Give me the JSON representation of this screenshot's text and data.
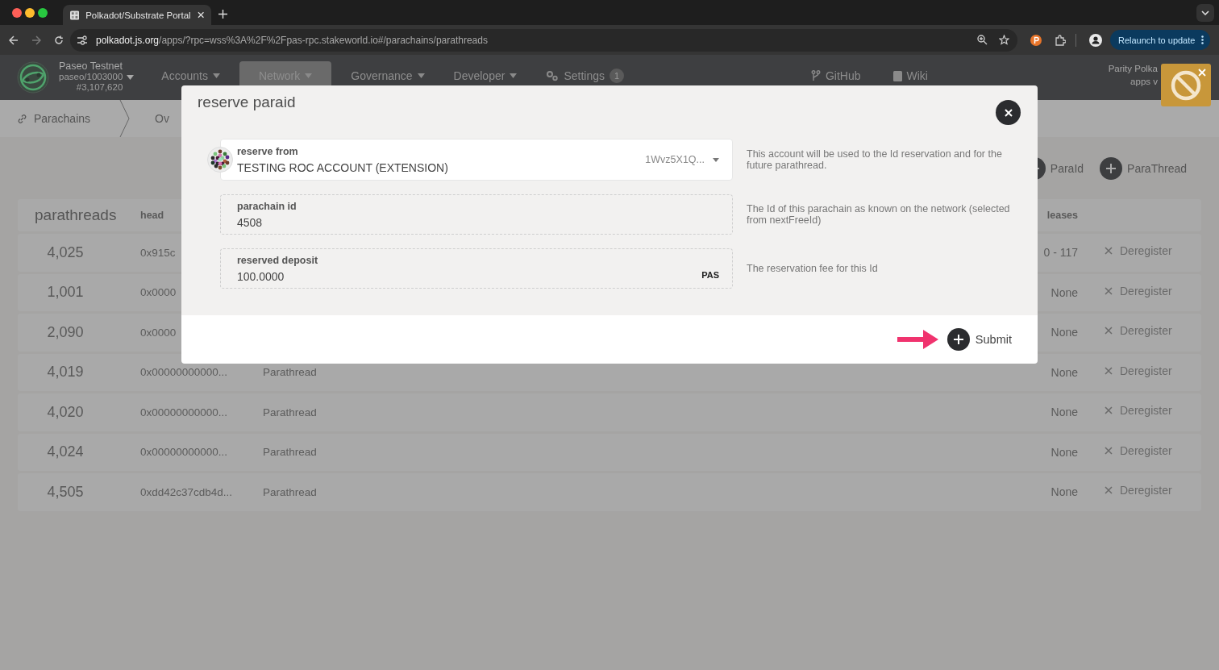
{
  "browser": {
    "tab_title": "Polkadot/Substrate Portal",
    "url_host": "polkadot.js.org",
    "url_rest": "/apps/?rpc=wss%3A%2F%2Fpas-rpc.stakeworld.io#/parachains/parathreads",
    "relaunch_button": "Relaunch to update"
  },
  "header": {
    "chain_name": "Paseo Testnet",
    "chain_spec": "paseo/1003000",
    "block": "#3,107,620",
    "nav": [
      {
        "label": "Accounts",
        "kind": "menu",
        "selected": false
      },
      {
        "label": "Network",
        "kind": "menu",
        "selected": true
      },
      {
        "label": "Governance",
        "kind": "menu",
        "selected": false
      },
      {
        "label": "Developer",
        "kind": "menu",
        "selected": false
      },
      {
        "label": "Settings",
        "kind": "settings",
        "selected": false,
        "badge": "1"
      },
      {
        "label": "GitHub",
        "kind": "github",
        "selected": false
      },
      {
        "label": "Wiki",
        "kind": "wiki",
        "selected": false
      }
    ],
    "version_lines": [
      "Parity Polka",
      "apps v"
    ]
  },
  "breadcrumb": {
    "section": "Parachains",
    "tab": "Ov"
  },
  "actions": [
    {
      "label": "ParaId"
    },
    {
      "label": "ParaThread"
    }
  ],
  "table": {
    "title": "parathreads",
    "columns": [
      "head",
      "leases"
    ],
    "rows": [
      {
        "id": "4,025",
        "head": "0x915c",
        "leases": "0 - 117",
        "action": "Deregister",
        "disabled": true
      },
      {
        "id": "1,001",
        "head": "0x0000",
        "leases": "None",
        "action": "Deregister",
        "disabled": true
      },
      {
        "id": "2,090",
        "head": "0x0000",
        "leases": "None",
        "action": "Deregister",
        "disabled": true
      },
      {
        "id": "4,019",
        "head": "0x00000000000...",
        "type": "Parathread",
        "leases": "None",
        "action": "Deregister",
        "disabled": true
      },
      {
        "id": "4,020",
        "head": "0x00000000000...",
        "type": "Parathread",
        "leases": "None",
        "action": "Deregister",
        "disabled": true
      },
      {
        "id": "4,024",
        "head": "0x00000000000...",
        "type": "Parathread",
        "leases": "None",
        "action": "Deregister",
        "disabled": true
      },
      {
        "id": "4,505",
        "head": "0xdd42c37cdb4d...",
        "type": "Parathread",
        "leases": "None",
        "action": "Deregister",
        "disabled": true
      }
    ]
  },
  "modal": {
    "title": "reserve paraid",
    "fields": [
      {
        "kind": "account",
        "label": "reserve from",
        "value": "TESTING ROC ACCOUNT (EXTENSION)",
        "address": "1Wvz5X1Q...",
        "help": "This account will be used to the Id reservation and for the future parathread."
      },
      {
        "kind": "text",
        "label": "parachain id",
        "value": "4508",
        "help": "The Id of this parachain as known on the network (selected from nextFreeId)"
      },
      {
        "kind": "amount",
        "label": "reserved deposit",
        "value": "100.0000",
        "unit": "PAS",
        "help": "The reservation fee for this Id"
      }
    ],
    "submit": "Submit"
  }
}
